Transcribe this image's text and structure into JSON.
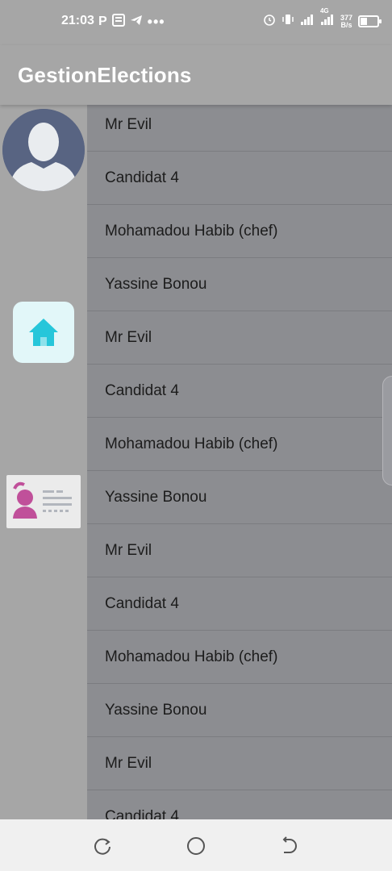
{
  "status_bar": {
    "time": "21:03",
    "left_icons": [
      "p-icon",
      "news-icon",
      "telegram-icon",
      "more-dots-icon"
    ],
    "speed_value": "377",
    "speed_unit": "B/s",
    "network_label": "4G",
    "right_icons": [
      "alarm-icon",
      "vibrate-icon",
      "signal-icon",
      "signal-4g-icon",
      "battery-icon"
    ]
  },
  "app_bar": {
    "title": "GestionElections"
  },
  "side_rail": {
    "items": [
      {
        "icon": "avatar-icon"
      },
      {
        "icon": "home-icon"
      },
      {
        "icon": "id-card-icon"
      }
    ]
  },
  "candidates": [
    "Mr Evil",
    "Candidat 4",
    "Mohamadou Habib (chef)",
    "Yassine Bonou",
    "Mr Evil",
    "Candidat 4",
    "Mohamadou Habib (chef)",
    "Yassine Bonou",
    "Mr Evil",
    "Candidat 4",
    "Mohamadou Habib (chef)",
    "Yassine Bonou",
    "Mr Evil",
    "Candidat 4"
  ],
  "nav_bar": {
    "buttons": [
      "recents-icon",
      "home-circle-icon",
      "back-icon"
    ]
  },
  "colors": {
    "scrim": "#a6a6a6",
    "list_bg": "#8c8d91",
    "home_accent": "#26c6da",
    "card_accent": "#c0509a",
    "avatar_bg": "#586482"
  }
}
